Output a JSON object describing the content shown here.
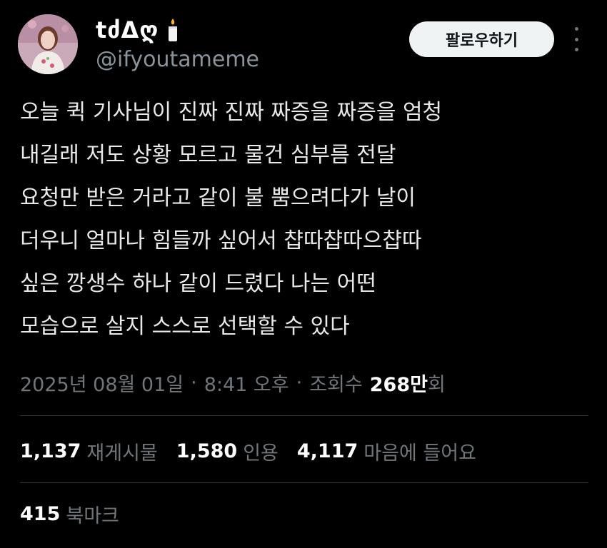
{
  "user": {
    "display_name": "tძΔღ",
    "handle": "@ifyoutameme",
    "follow_label": "팔로우하기"
  },
  "tweet": {
    "lines": [
      "오늘 퀵 기사님이 진짜 진짜 짜증을 짜증을 엄청",
      "내길래 저도 상황 모르고 물건 심부름 전달",
      "요청만 받은 거라고 같이 불 뿜으려다가 날이",
      "더우니 얼마나 힘들까 싶어서 챱따챱따으챱따",
      "싶은 깡생수 하나 같이 드렸다 나는 어떤",
      "모습으로 살지 스스로 선택할 수 있다"
    ]
  },
  "meta": {
    "date": "2025년 08월 01일",
    "separator": "·",
    "time": "8:41 오후",
    "views_label": "조회수",
    "views_count": "268만",
    "views_unit": "회"
  },
  "stats": {
    "retweets_count": "1,137",
    "retweets_label": "재게시물",
    "quotes_count": "1,580",
    "quotes_label": "인용",
    "likes_count": "4,117",
    "likes_label": "마음에 들어요",
    "bookmarks_count": "415",
    "bookmarks_label": "북마크"
  },
  "colors": {
    "background": "#000000",
    "text": "#e7e9ea",
    "secondary_text": "#71767b",
    "divider": "#2f3336",
    "button_bg": "#eff3f4",
    "button_text": "#0f1419"
  },
  "icons": {
    "name_emoji": "candle-icon",
    "menu": "more-icon"
  }
}
